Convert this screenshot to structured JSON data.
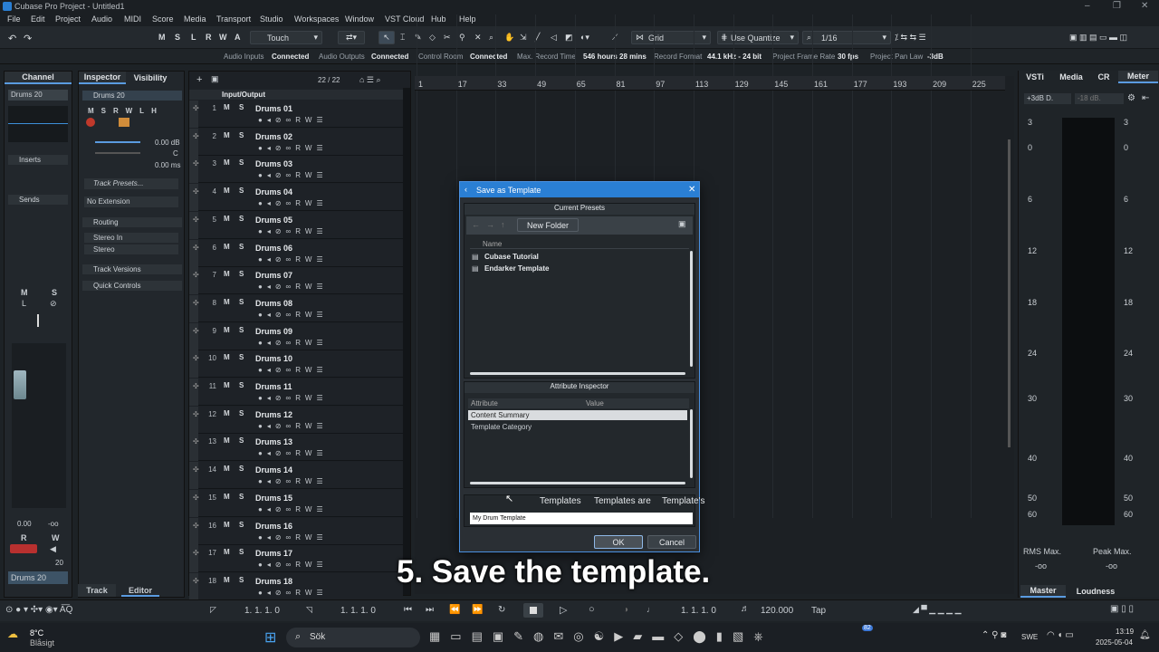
{
  "titlebar": {
    "title": "Cubase Pro Project - Untitled1"
  },
  "menu": [
    "File",
    "Edit",
    "Project",
    "Audio",
    "MIDI",
    "Score",
    "Media",
    "Transport",
    "Studio",
    "Workspaces",
    "Window",
    "VST Cloud",
    "Hub",
    "Help"
  ],
  "toolbar": {
    "mode_buttons": [
      "M",
      "S",
      "L",
      "R",
      "W",
      "A"
    ],
    "automation_mode": "Touch",
    "snap_type": "Grid",
    "quantize_mode": "Use Quantize",
    "quantize_value": "1/16"
  },
  "status": {
    "audio_inputs_label": "Audio Inputs",
    "audio_inputs_val": "Connected",
    "audio_outputs_label": "Audio Outputs",
    "audio_outputs_val": "Connected",
    "control_room_label": "Control Room",
    "control_room_val": "Connected",
    "max_record_label": "Max. Record Time",
    "max_record_val": "546 hours 28 mins",
    "record_format_label": "Record Format",
    "record_format_val": "44.1 kHz - 24 bit",
    "frame_rate_label": "Project Frame Rate",
    "frame_rate_val": "30 fps",
    "pan_law_label": "Project Pan Law",
    "pan_law_val": "-3dB"
  },
  "channel": {
    "tab": "Channel",
    "track_name": "Drums 20",
    "inserts": "Inserts",
    "sends": "Sends",
    "m": "M",
    "s": "S",
    "l": "L",
    "fader_val": "0.00",
    "pan_val": "-oo",
    "r": "R",
    "w": "W",
    "vol_num": "20",
    "bottom_name": "Drums 20"
  },
  "inspector": {
    "tab": "Inspector",
    "tab2": "Visibility",
    "track_name": "Drums 20",
    "gain": "0.00 dB",
    "pan": "C",
    "delay": "0.00 ms",
    "presets": "Track Presets...",
    "no_ext": "No Extension",
    "routing": "Routing",
    "in": "Stereo In",
    "out": "Stereo",
    "versions": "Track Versions",
    "quick": "Quick Controls"
  },
  "tracklist": {
    "count": "22 / 22",
    "folder": "Input/Output",
    "tracks": [
      {
        "n": "1",
        "name": "Drums 01"
      },
      {
        "n": "2",
        "name": "Drums 02"
      },
      {
        "n": "3",
        "name": "Drums 03"
      },
      {
        "n": "4",
        "name": "Drums 04"
      },
      {
        "n": "5",
        "name": "Drums 05"
      },
      {
        "n": "6",
        "name": "Drums 06"
      },
      {
        "n": "7",
        "name": "Drums 07"
      },
      {
        "n": "8",
        "name": "Drums 08"
      },
      {
        "n": "9",
        "name": "Drums 09"
      },
      {
        "n": "10",
        "name": "Drums 10"
      },
      {
        "n": "11",
        "name": "Drums 11"
      },
      {
        "n": "12",
        "name": "Drums 12"
      },
      {
        "n": "13",
        "name": "Drums 13"
      },
      {
        "n": "14",
        "name": "Drums 14"
      },
      {
        "n": "15",
        "name": "Drums 15"
      },
      {
        "n": "16",
        "name": "Drums 16"
      },
      {
        "n": "17",
        "name": "Drums 17"
      },
      {
        "n": "18",
        "name": "Drums 18"
      }
    ]
  },
  "ruler": [
    "1",
    "17",
    "33",
    "49",
    "65",
    "81",
    "97",
    "113",
    "129",
    "145",
    "161",
    "177",
    "193",
    "209",
    "225"
  ],
  "right": {
    "tabs": [
      "VSTi",
      "Media",
      "CR",
      "Meter"
    ],
    "db1": "+3dB D.",
    "db2": "-18 dB.",
    "scale": [
      "3",
      "0",
      "6",
      "12",
      "18",
      "24",
      "30",
      "40",
      "50",
      "60"
    ],
    "rms": "RMS Max.",
    "peak": "Peak Max.",
    "rms_v": "-oo",
    "peak_v": "-oo",
    "master": "Master",
    "loudness": "Loudness"
  },
  "dialog": {
    "title": "Save as Template",
    "presets_header": "Current Presets",
    "new_folder": "New Folder",
    "name_col": "Name",
    "presets": [
      "Cubase Tutorial",
      "Endarker Template"
    ],
    "attr_header": "Attribute Inspector",
    "attr_col": "Attribute",
    "value_col": "Value",
    "attrs": [
      "Content Summary",
      "Template Category"
    ],
    "name_value": "My Drum Template",
    "ok": "OK",
    "cancel": "Cancel",
    "suggestions": [
      "Templates",
      "Templates are",
      "Template's"
    ]
  },
  "transport": {
    "left_loc": "1. 1. 1. 0",
    "right_loc": "1. 1. 1. 0",
    "pos": "1. 1. 1. 0",
    "tempo": "120.000",
    "tap": "Tap"
  },
  "bottom_tabs": {
    "track": "Track",
    "editor": "Editor"
  },
  "caption": "5. Save the template.",
  "taskbar": {
    "temp": "8°C",
    "weather": "Blåsigt",
    "search": "Sök",
    "lang": "SWE",
    "time": "13:19",
    "date": "2025-05-04",
    "badge": "82"
  }
}
